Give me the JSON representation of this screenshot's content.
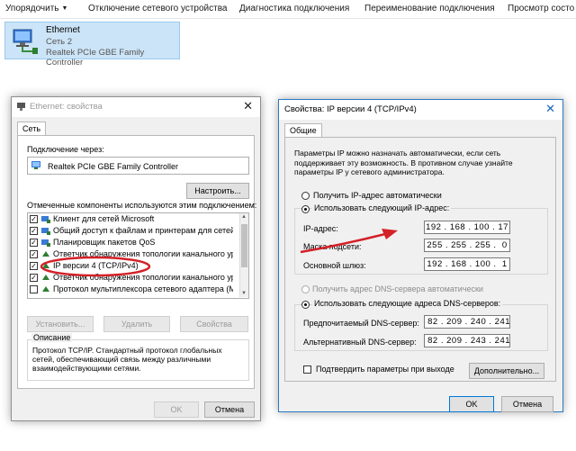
{
  "toolbar": {
    "organize": "Упорядочить",
    "disconnect": "Отключение сетевого устройства",
    "diagnose": "Диагностика подключения",
    "rename": "Переименование подключения",
    "view_status": "Просмотр состо"
  },
  "adapter": {
    "name": "Ethernet",
    "network": "Сеть 2",
    "device": "Realtek PCIe GBE Family Controller"
  },
  "props": {
    "title": "Ethernet: свойства",
    "close": "✕",
    "tab": "Сеть",
    "connect_via_label": "Подключение через:",
    "adapter_name": "Realtek PCIe GBE Family Controller",
    "configure": "Настроить...",
    "components_label": "Отмеченные компоненты используются этим подключением:",
    "components": [
      {
        "label": "Клиент для сетей Microsoft",
        "checked": true
      },
      {
        "label": "Общий доступ к файлам и принтерам для сетей M",
        "checked": true
      },
      {
        "label": "Планировщик пакетов QoS",
        "checked": true
      },
      {
        "label": "Ответчик обнаружения топологии канального уров",
        "checked": true
      },
      {
        "label": "IP версии 4 (TCP/IPv4)",
        "checked": true
      },
      {
        "label": "Ответчик обнаружения топологии канального уров",
        "checked": true
      },
      {
        "label": "Протокол мультиплексора сетевого адаптера (Ma",
        "checked": false
      }
    ],
    "install": "Установить...",
    "remove": "Удалить",
    "properties": "Свойства",
    "description_label": "Описание",
    "description": "Протокол TCP/IP. Стандартный протокол глобальных сетей, обеспечивающий связь между различными взаимодействующими сетями.",
    "ok": "OK",
    "cancel": "Отмена"
  },
  "ipv4": {
    "title": "Свойства: IP версии 4 (TCP/IPv4)",
    "close": "✕",
    "tab": "Общие",
    "intro": "Параметры IP можно назначать автоматически, если сеть поддерживает эту возможность. В противном случае узнайте параметры IP у сетевого администратора.",
    "auto_ip": "Получить IP-адрес автоматически",
    "manual_ip": "Использовать следующий IP-адрес:",
    "ip_label": "IP-адрес:",
    "ip_value": "192 . 168 . 100 . 17",
    "mask_label": "Маска подсети:",
    "mask_value": "255 . 255 . 255 .  0",
    "gateway_label": "Основной шлюз:",
    "gateway_value": "192 . 168 . 100 .  1",
    "auto_dns": "Получить адрес DNS-сервера автоматически",
    "manual_dns": "Использовать следующие адреса DNS-серверов:",
    "preferred_dns_label": "Предпочитаемый DNS-сервер:",
    "preferred_dns_value": " 82 . 209 . 240 . 241",
    "alt_dns_label": "Альтернативный DNS-сервер:",
    "alt_dns_value": " 82 . 209 . 243 . 241",
    "validate": "Подтвердить параметры при выходе",
    "advanced": "Дополнительно...",
    "ok": "OK",
    "cancel": "Отмена"
  },
  "colors": {
    "annotation_red": "#d42027",
    "selection_blue": "#cce4f7",
    "focus_blue": "#0078d7"
  }
}
